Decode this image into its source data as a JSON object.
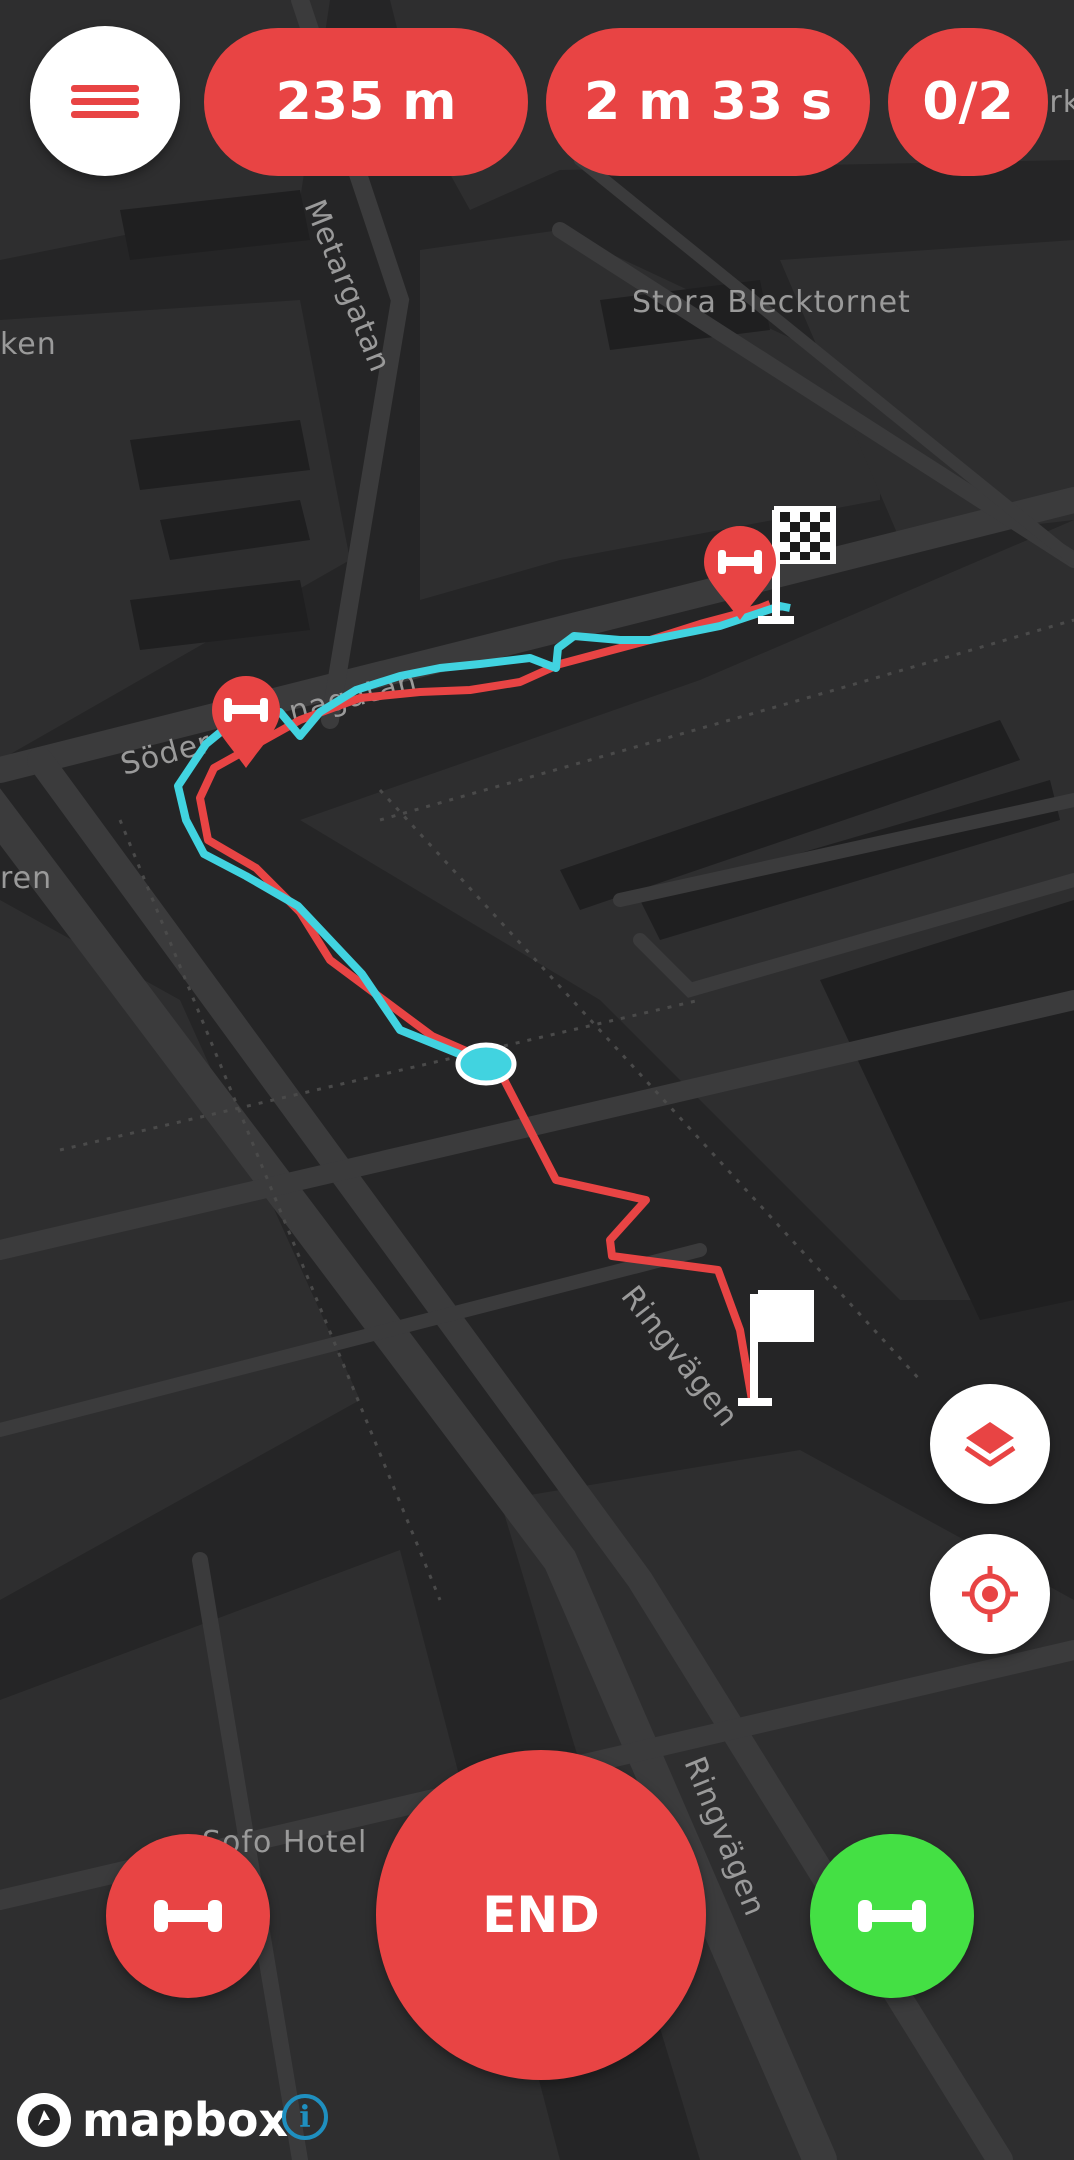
{
  "header": {
    "distance": "235 m",
    "duration": "2 m 33 s",
    "progress": "0/2"
  },
  "map": {
    "labels": {
      "metargatan": "Metargatan",
      "stora_blecktornet": "Stora Blecktornet",
      "ken": "ken",
      "ren": "ren",
      "soder": "Söder",
      "nagatan": "nagatan",
      "ringvagen_1": "Ringvägen",
      "ringvagen_2": "Ringvägen",
      "sofo_hotel": "Sofo Hotel",
      "ark": "ark"
    },
    "colors": {
      "background": "#252526",
      "block": "#2e2e2f",
      "road": "#3b3b3c",
      "planned_route": "#e84444",
      "tracked_route": "#41d3e0"
    }
  },
  "controls": {
    "end_label": "END",
    "layers_icon": "layers-icon",
    "locate_icon": "crosshair-icon",
    "left_icon": "dumbbell-icon",
    "right_icon": "dumbbell-icon",
    "left_color": "#e84444",
    "right_color": "#44e044"
  },
  "footer": {
    "brand": "mapbox",
    "info_icon": "info-icon"
  }
}
